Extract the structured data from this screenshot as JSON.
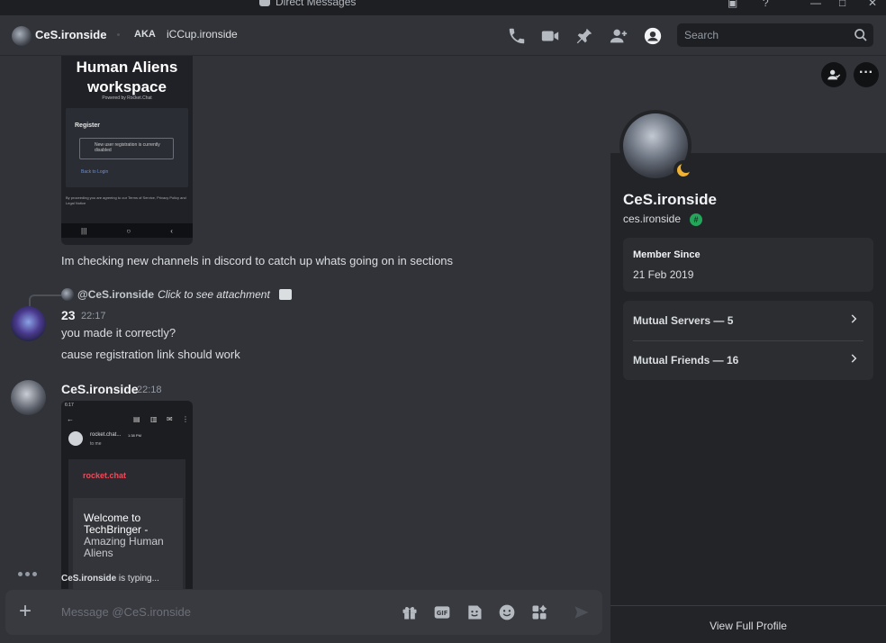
{
  "window": {
    "title": "Direct Messages"
  },
  "header": {
    "username": "CeS.ironside",
    "aka_label": "AKA",
    "aka_value": "iCCup.ironside",
    "search_placeholder": "Search"
  },
  "messages": {
    "attachment1": {
      "workspace_title": "Human Aliens workspace",
      "powered_by": "Powered by Rocket.Chat",
      "register": "Register",
      "warning": "New user registration is currently disabled",
      "back": "Back to Login",
      "terms": "By proceeding you are agreeing to our Terms of Service, Privacy Policy and Legal Notice"
    },
    "text1": "Im checking new channels in discord to catch up whats going on in sections",
    "reply": {
      "author": "@CeS.ironside",
      "text": "Click to see attachment"
    },
    "msg2": {
      "author": "23",
      "time": "22:17",
      "line1": "you made it correctly?",
      "line2": "cause registration link should work"
    },
    "msg3": {
      "author": "CeS.ironside",
      "time": "22:18"
    },
    "attachment2": {
      "status_time": "6:17",
      "sender": "rocket.chat...",
      "sender_time": "1:38 PM",
      "to": "to me",
      "logo": "rocket.chat",
      "welcome_line1": "Welcome to",
      "welcome_line2": "TechBringer -",
      "welcome_line3": "Amazing Human",
      "welcome_line4": "Aliens"
    }
  },
  "typing": {
    "user": "CeS.ironside",
    "suffix": "is typing..."
  },
  "composer": {
    "placeholder": "Message @CeS.ironside"
  },
  "profile": {
    "display_name": "CeS.ironside",
    "username": "ces.ironside",
    "member_since_label": "Member Since",
    "member_since_value": "21 Feb 2019",
    "mutual_servers": "Mutual Servers — 5",
    "mutual_friends": "Mutual Friends — 16",
    "view_full_profile": "View Full Profile"
  },
  "colors": {
    "background": "#313338",
    "panel": "#232428",
    "status_idle": "#f0b232",
    "badge_green": "#23a55a"
  }
}
